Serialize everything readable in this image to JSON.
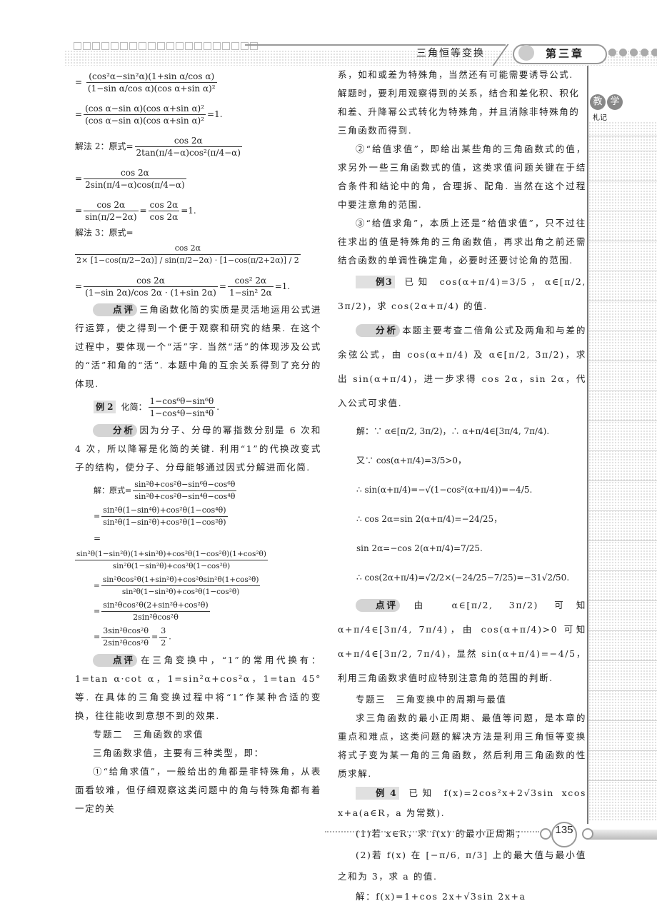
{
  "header": {
    "section_title": "三角恒等变换",
    "chapter": "第三章",
    "rail_badge": [
      "教",
      "学"
    ],
    "rail_label": "札记"
  },
  "left_column": {
    "m1_lhs": "=",
    "m1_num": "(cos²α−sin²α)(1+sin α/cos α)",
    "m1_den": "(1−sin α/cos α)(cos α+sin α)²",
    "m2_num": "(cos α−sin α)(cos α+sin α)²",
    "m2_den": "(cos α−sin α)(cos α+sin α)²",
    "m2_tail": "=1.",
    "sol2_label": "解法 2：原式=",
    "m3_num": "cos 2α",
    "m3_den": "2tan(π/4−α)cos²(π/4−α)",
    "m4_num": "cos 2α",
    "m4_den": "2sin(π/4−α)cos(π/4−α)",
    "m5_num": "cos 2α",
    "m5_den": "sin(π/2−2α)",
    "m5_num2": "cos 2α",
    "m5_den2": "cos 2α",
    "m5_tail": "=1.",
    "sol3_label": "解法 3：原式=",
    "m6_num": "cos 2α",
    "m6_den": "2× [1−cos(π/2−2α)] / sin(π/2−2α) · [1−cos(π/2+2α)] / 2",
    "m7_num": "cos 2α",
    "m7_den": "(1−sin 2α)/cos 2α · (1+sin 2α)",
    "m7_num2": "cos² 2α",
    "m7_den2": "1−sin² 2α",
    "m7_tail": "=1.",
    "comment1_tag": "点评",
    "comment1": "三角函数化简的实质是灵活地运用公式进行运算，使之得到一个便于观察和研究的结果. 在这个过程中，要体现一个“活”字. 当然“活”的体现涉及公式的“活”和角的“活”. 本题中角的互余关系得到了充分的体现.",
    "ex2_tag": "例 2",
    "ex2_text": "化简：",
    "ex2_num": "1−cos⁶θ−sin⁶θ",
    "ex2_den": "1−cos⁴θ−sin⁴θ",
    "analysis2_tag": "分析",
    "analysis2": "因为分子、分母的幂指数分别是 6 次和 4 次，所以降幂是化简的关键. 利用“1”的代换改变式子的结构，使分子、分母能够通过因式分解进而化简.",
    "sol_label": "解：原式=",
    "s1_num": "sin²θ+cos²θ−sin⁶θ−cos⁶θ",
    "s1_den": "sin²θ+cos²θ−sin⁴θ−cos⁴θ",
    "s2_num": "sin²θ(1−sin⁴θ)+cos²θ(1−cos⁴θ)",
    "s2_den": "sin²θ(1−sin²θ)+cos²θ(1−cos²θ)",
    "s3_eq": "=",
    "s3_num": "sin²θ(1−sin²θ)(1+sin²θ)+cos²θ(1−cos²θ)(1+cos²θ)",
    "s3_den": "sin²θ(1−sin²θ)+cos²θ(1−cos²θ)",
    "s4_num": "sin²θcos²θ(1+sin²θ)+cos²θsin²θ(1+cos²θ)",
    "s4_den": "sin²θ(1−sin²θ)+cos²θ(1−cos²θ)",
    "s5_num": "sin²θcos²θ(2+sin²θ+cos²θ)",
    "s5_den": "2sin²θcos²θ",
    "s6_num": "3sin²θcos²θ",
    "s6_den": "2sin²θcos²θ",
    "s6_num2": "3",
    "s6_den2": "2",
    "comment2_tag": "点评",
    "comment2": "在三角变换中，“1”的常用代换有：1=tan α·cot α，1=sin²α+cos²α，1=tan 45°等. 在具体的三角变换过程中将“1”作某种合适的变换，往往能收到意想不到的效果.",
    "topic2": "专题二　三角函数的求值",
    "topic2_intro": "三角函数求值，主要有三种类型，即：",
    "type1": "①“给角求值”，一般给出的角都是非特殊角，从表面看较难，但仔细观察这类问题中的角与特殊角都有着一定的关"
  },
  "right_column": {
    "type1_cont": "系，如和或差为特殊角，当然还有可能需要诱导公式. 解题时，要利用观察得到的关系，结合和差化积、积化和差、升降幂公式转化为特殊角，并且消除非特殊角的三角函数而得到.",
    "type2": "②“给值求值”，即给出某些角的三角函数式的值，求另外一些三角函数式的值，这类求值问题关键在于结合条件和结论中的角，合理拆、配角. 当然在这个过程中要注意角的范围.",
    "type3": "③“给值求角”，本质上还是“给值求值”，只不过往往求出的值是特殊角的三角函数值，再求出角之前还需结合函数的单调性确定角，必要时还要讨论角的范围.",
    "ex3_tag": "例3",
    "ex3": "已知 cos(α+π/4)=3/5，α∈[π/2, 3π/2)，求 cos(2α+π/4) 的值.",
    "analysis3_tag": "分析",
    "analysis3": "本题主要考查二倍角公式及两角和与差的余弦公式，由 cos(α+π/4) 及 α∈[π/2, 3π/2)，求出 sin(α+π/4)，进一步求得 cos 2α，sin 2α，代入公式可求值.",
    "r1": "解：∵ α∈[π/2, 3π/2)，∴ α+π/4∈[3π/4, 7π/4).",
    "r2": "又∵ cos(α+π/4)=3/5>0，",
    "r3": "∴ sin(α+π/4)=−√(1−cos²(α+π/4))=−4/5.",
    "r4": "∴ cos 2α=sin 2(α+π/4)=−24/25，",
    "r5": "sin 2α=−cos 2(α+π/4)=7/25.",
    "r6": "∴ cos(2α+π/4)=√2/2×(−24/25−7/25)=−31√2/50.",
    "comment3_tag": "点评",
    "comment3": "由 α∈[π/2, 3π/2) 可知 α+π/4∈[3π/4, 7π/4)，由 cos(α+π/4)>0 可知 α+π/4∈[3π/2, 7π/4)，显然 sin(α+π/4)=−4/5，利用三角函数求值时应特别注意角的范围的判断.",
    "topic3": "专题三　三角变换中的周期与最值",
    "topic3_intro": "求三角函数的最小正周期、最值等问题，是本章的重点和难点，这类问题的解决方法是利用三角恒等变换将式子变为某一角的三角函数，然后利用三角函数的性质求解.",
    "ex4_tag": "例 4",
    "ex4": "已知 f(x)=2cos²x+2√3sin xcos x+a(a∈R，a 为常数).",
    "ex4_q1": "(1)若 x∈R，求 f(x) 的最小正周期；",
    "ex4_q2": "(2)若 f(x) 在 [−π/6, π/3] 上的最大值与最小值之和为 3，求 a 的值.",
    "ex4_sol": "解：f(x)=1+cos 2x+√3sin 2x+a"
  },
  "footer": {
    "page_number": "135"
  }
}
